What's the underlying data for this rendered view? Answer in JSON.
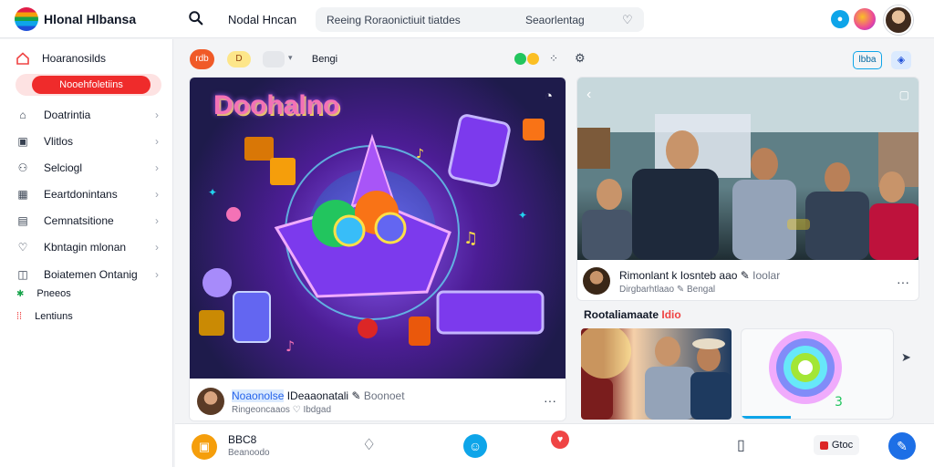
{
  "app": {
    "brand": "Hlonal Hlbansa"
  },
  "topbar": {
    "nav_link": "Nodal Hncan",
    "search": {
      "query": "Reeing Roraonictiuit tiatdes",
      "scope": "Seaorlentag"
    }
  },
  "sidebar": {
    "home_label": "Hoaranosilds",
    "active_label": "Nooehfoletiins",
    "items": [
      {
        "label": "Doatrintia",
        "icon": "home-icon"
      },
      {
        "label": "Vlitlos",
        "icon": "video-icon"
      },
      {
        "label": "Selciogl",
        "icon": "users-icon"
      },
      {
        "label": "Eeartdonintans",
        "icon": "calendar-icon"
      },
      {
        "label": "Cemnatsitione",
        "icon": "gamepad-icon"
      },
      {
        "label": "Kbntagin mlonan",
        "icon": "heart-icon"
      },
      {
        "label": "Boiatemen Ontanig",
        "icon": "book-icon"
      }
    ],
    "small_items": [
      {
        "label": "Pneeos"
      },
      {
        "label": "Lentiuns"
      }
    ]
  },
  "filters": {
    "chip_red": "rdb",
    "chip_yellow": "D",
    "tag": "Bengi",
    "btn_outline": "lbba",
    "btn_blue": "◈"
  },
  "hero": {
    "title": "Doohalno",
    "author_highlight": "Noaonolse",
    "author_name": "IDeaaonatali",
    "author_suffix": "Boonoet",
    "meta": "Ringeoncaaos",
    "meta_suffix": "Ibdgad"
  },
  "video": {
    "title": "Rimonlant k Iosnteb aao",
    "title_suffix": "Ioolar",
    "meta": "Dirgbarhtlaao",
    "meta_suffix": "Bengal"
  },
  "section": {
    "title": "Rootaliamaate",
    "accent": "Idio"
  },
  "bottombar": {
    "title": "BBC8",
    "subtitle": "Beanoodo",
    "chip": "Gtoc"
  },
  "colors": {
    "accent_red": "#ef2b2b",
    "accent_blue": "#1d6fe6",
    "hero_bg": "#4c1d95"
  }
}
